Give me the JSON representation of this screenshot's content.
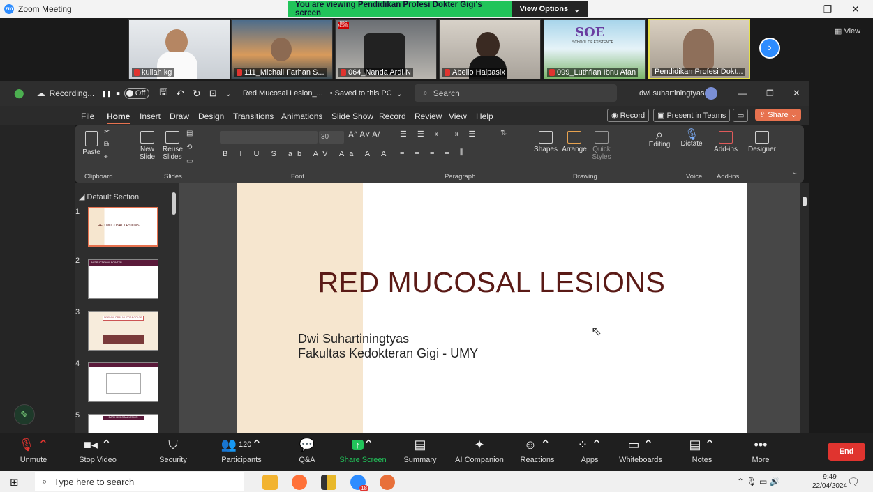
{
  "zoom": {
    "app_title": "Zoom Meeting",
    "logo_text": "zm",
    "banner": "You are viewing Pendidikan Profesi Dokter Gigi's screen",
    "view_options": "View Options",
    "view_label": "View",
    "participants": [
      {
        "name": "kuliah kg"
      },
      {
        "name": "111_Michail Farhan S..."
      },
      {
        "name": "064_Nanda Ardi N"
      },
      {
        "name": "Abelio Halpasix"
      },
      {
        "name": "099_Luthfian Ibnu Afan"
      },
      {
        "name": "Pendidikan Profesi Dokt..."
      }
    ],
    "thumb_tiny_texts": {
      "news1": "BBC NEWS",
      "news2": "BBC",
      "soe": "SOE",
      "soe_sub": "SCHOOL OF EXISTENCE"
    },
    "recording": {
      "label": "Recording...",
      "toggle": "Off"
    },
    "toolbar": [
      {
        "label": "Unmute",
        "icon": "mic-muted-icon"
      },
      {
        "label": "Stop Video",
        "icon": "video-icon"
      },
      {
        "label": "Security",
        "icon": "shield-icon"
      },
      {
        "label": "Participants",
        "icon": "people-icon",
        "count": "120"
      },
      {
        "label": "Q&A",
        "icon": "qa-icon"
      },
      {
        "label": "Share Screen",
        "icon": "share-icon"
      },
      {
        "label": "Summary",
        "icon": "summary-icon"
      },
      {
        "label": "AI Companion",
        "icon": "sparkle-icon"
      },
      {
        "label": "Reactions",
        "icon": "smile-icon"
      },
      {
        "label": "Apps",
        "icon": "apps-icon"
      },
      {
        "label": "Whiteboards",
        "icon": "whiteboard-icon"
      },
      {
        "label": "Notes",
        "icon": "notes-icon"
      },
      {
        "label": "More",
        "icon": "more-icon"
      }
    ],
    "end_label": "End"
  },
  "ppt": {
    "file_name": "Red Mucosal Lesion_...",
    "saved_status": "• Saved to this PC",
    "search_placeholder": "Search",
    "user_name": "dwi suhartiningtyas",
    "tabs": [
      "File",
      "Home",
      "Insert",
      "Draw",
      "Design",
      "Transitions",
      "Animations",
      "Slide Show",
      "Record",
      "Review",
      "View",
      "Help"
    ],
    "active_tab": "Home",
    "record_btn": "Record",
    "present_btn": "Present in Teams",
    "share_btn": "Share",
    "ribbon": {
      "paste": "Paste",
      "clipboard": "Clipboard",
      "new_slide_1": "New",
      "new_slide_2": "Slide",
      "reuse_1": "Reuse",
      "reuse_2": "Slides",
      "slides_group": "Slides",
      "font_size": "30",
      "font_group": "Font",
      "paragraph_group": "Paragraph",
      "shapes": "Shapes",
      "arrange": "Arrange",
      "quick_styles_1": "Quick",
      "quick_styles_2": "Styles",
      "drawing_group": "Drawing",
      "editing": "Editing",
      "dictate": "Dictate",
      "voice_group": "Voice",
      "addins": "Add-ins",
      "addins_group": "Add-ins",
      "designer": "Designer"
    },
    "section": "Default Section",
    "thumbs": [
      {
        "num": "1",
        "title": "RED MUCOSAL LESIONS"
      },
      {
        "num": "2",
        "title": "INSTRUCTIONAL POINTER"
      },
      {
        "num": "3",
        "title": "NORMAL ORAL MUCOSA COLOR"
      },
      {
        "num": "4",
        "title": ""
      },
      {
        "num": "5",
        "title": "DARK MUCOSAL LESION"
      }
    ],
    "slide": {
      "title": "RED MUCOSAL LESIONS",
      "author": "Dwi Suhartiningtyas",
      "affiliation": "Fakultas Kedokteran Gigi - UMY"
    }
  },
  "taskbar": {
    "search_placeholder": "Type here to search",
    "time": "9:49",
    "date": "22/04/2024",
    "zoom_badge": "18"
  }
}
